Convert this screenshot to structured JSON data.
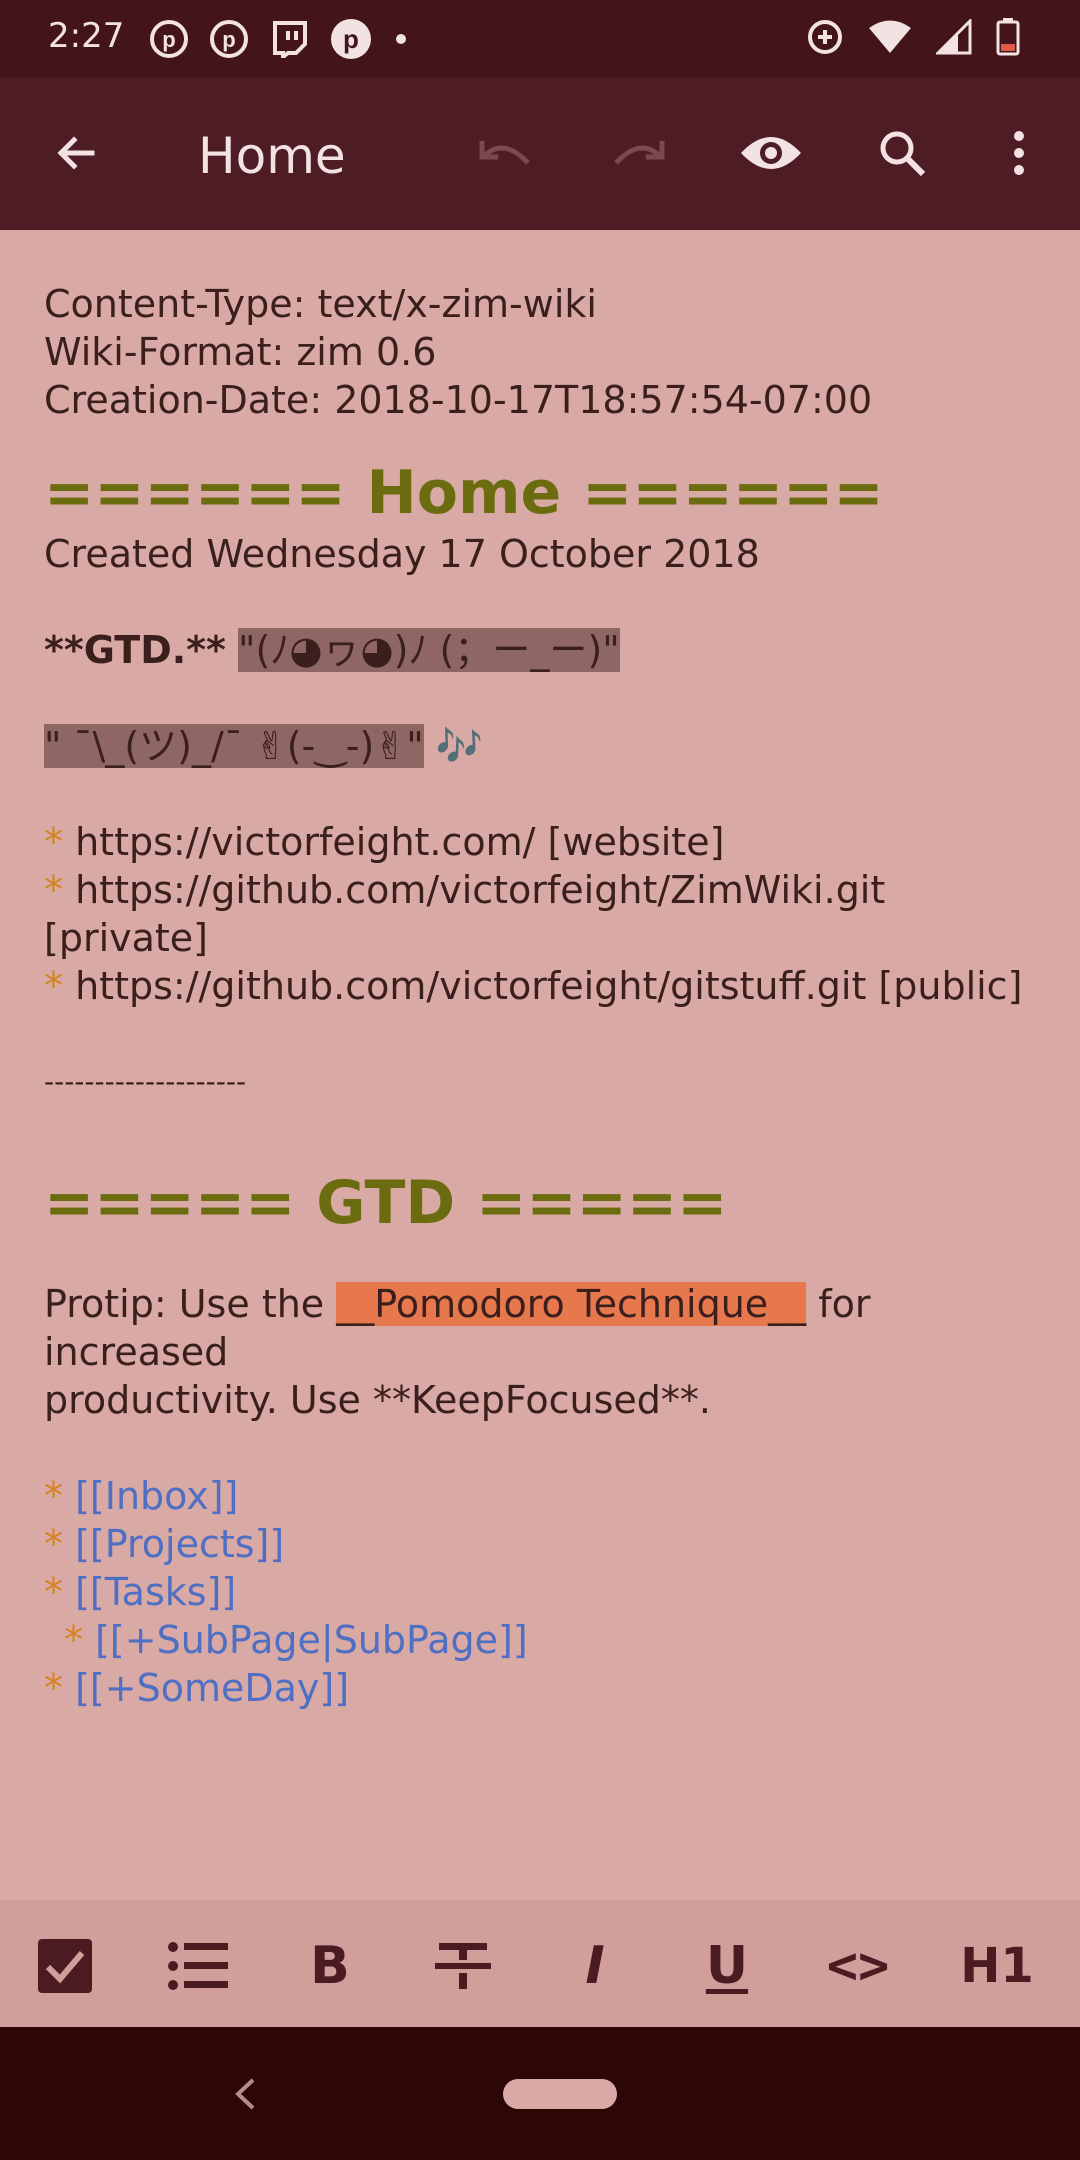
{
  "status": {
    "time": "2:27",
    "left_icons": [
      "pinterest-icon",
      "pinterest-icon",
      "twitch-icon",
      "pinterest-icon",
      "dot-icon"
    ],
    "right_icons": [
      "data-saver-icon",
      "wifi-icon",
      "signal-icon",
      "battery-icon"
    ]
  },
  "appbar": {
    "title": "Home",
    "icons": [
      "back-arrow-icon",
      "undo-icon",
      "redo-icon",
      "preview-eye-icon",
      "search-icon",
      "more-vert-icon"
    ]
  },
  "doc": {
    "meta": [
      "Content-Type: text/x-zim-wiki",
      "Wiki-Format: zim 0.6",
      "Creation-Date: 2018-10-17T18:57:54-07:00"
    ],
    "heading1": "====== Home ======",
    "created": "Created Wednesday 17 October 2018",
    "gtd_bold": "**GTD.**",
    "gtd_highlight": "\"(ﾉ◕ヮ◕)ﾉ (；ー_ー)\"",
    "shrug_highlight": "\" ¯\\_(ツ)_/¯ ✌(-‿-)✌\"",
    "music": "🎶",
    "bullet": "*",
    "urls": [
      "https://victorfeight.com/ [website]",
      "https://github.com/victorfeight/ZimWiki.git [private]",
      "https://github.com/victorfeight/gitstuff.git [public]"
    ],
    "divider": "--------------------",
    "heading2": "===== GTD =====",
    "protip_before": "Protip: Use the ",
    "protip_highlight": "__Pomodoro Technique__",
    "protip_after": " for increased",
    "protip_line2": "productivity. Use **KeepFocused**.",
    "links": [
      "[[Inbox]]",
      "[[Projects]]",
      "[[Tasks]]",
      "[[+SubPage|SubPage]]",
      "[[+SomeDay]]"
    ]
  },
  "toolbar": {
    "bold": "B",
    "italic": "I",
    "underline": "U",
    "code": "<>",
    "heading": "H1"
  },
  "colors": {
    "page_bg": "#d9a9a6",
    "appbar": "#4d1c24",
    "heading": "#6b6c0f",
    "bullet": "#d5831e",
    "link": "#4e6fc2",
    "highlight": "#e7784e"
  }
}
